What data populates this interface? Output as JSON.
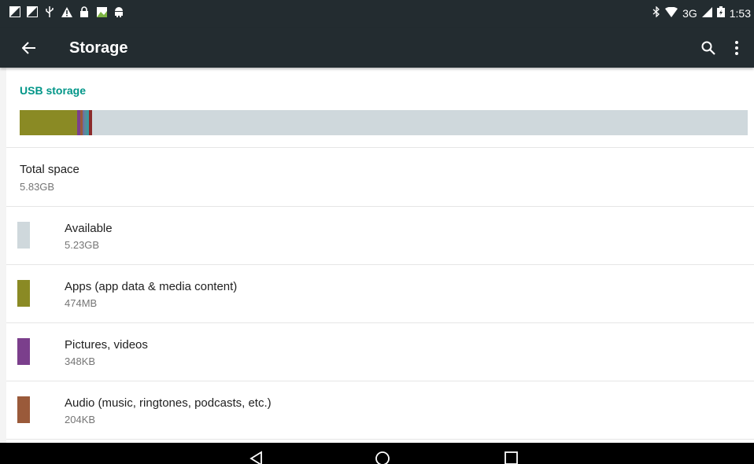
{
  "status_bar": {
    "time": "1:53",
    "network": "3G",
    "left_icons": [
      "image-notification-icon",
      "image-notification-icon",
      "usb-icon",
      "warning-icon",
      "lock-icon",
      "gallery-icon",
      "android-icon"
    ],
    "right_icons": [
      "bluetooth-icon",
      "wifi-icon",
      "signal-icon",
      "battery-icon"
    ]
  },
  "toolbar": {
    "title": "Storage",
    "back_icon": "arrow-back-icon",
    "search_icon": "search-icon",
    "more_icon": "more-vert-icon"
  },
  "section": {
    "header": "USB storage"
  },
  "storage_bar": {
    "total_bytes_label": "5.83GB",
    "segments": [
      {
        "name": "apps",
        "color": "#8a8a24",
        "fraction": 0.079
      },
      {
        "name": "pictures",
        "color": "#7b3f8c",
        "fraction": 0.004
      },
      {
        "name": "audio",
        "color": "#9a5a3a",
        "fraction": 0.003
      },
      {
        "name": "other1",
        "color": "#6f6f9f",
        "fraction": 0.003
      },
      {
        "name": "other2",
        "color": "#5a8a9a",
        "fraction": 0.003
      },
      {
        "name": "other3",
        "color": "#3f9aa0",
        "fraction": 0.003
      },
      {
        "name": "other4",
        "color": "#8c2b2b",
        "fraction": 0.004
      }
    ],
    "available_color": "#cfd8dc"
  },
  "total": {
    "title": "Total space",
    "value": "5.83GB"
  },
  "items": [
    {
      "title": "Available",
      "value": "5.23GB",
      "color": "#cfd8dc"
    },
    {
      "title": "Apps (app data & media content)",
      "value": "474MB",
      "color": "#8a8a24"
    },
    {
      "title": "Pictures, videos",
      "value": "348KB",
      "color": "#7b3f8c"
    },
    {
      "title": "Audio (music, ringtones, podcasts, etc.)",
      "value": "204KB",
      "color": "#9a5a3a"
    }
  ],
  "nav_bar": {
    "back_icon": "nav-back-icon",
    "home_icon": "nav-home-icon",
    "recents_icon": "nav-recents-icon"
  }
}
